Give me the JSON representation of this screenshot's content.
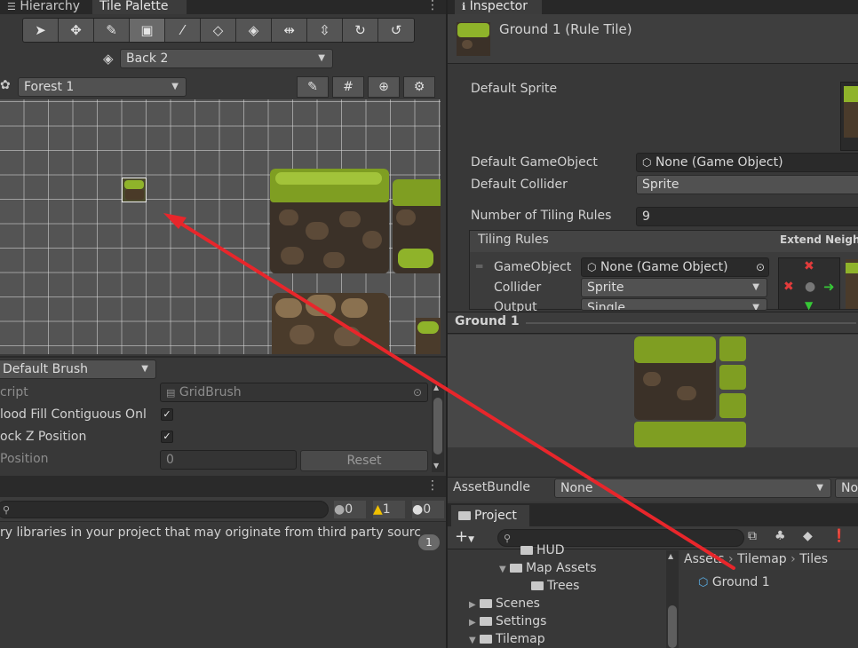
{
  "left_tabs": {
    "hierarchy": "Hierarchy",
    "tile_palette": "Tile Palette"
  },
  "toolbar": {
    "tools": [
      "select-arrow-icon",
      "move-icon",
      "paintbrush-icon",
      "box-fill-icon",
      "picker-icon",
      "eraser-icon",
      "bucket-icon",
      "flip-x-icon",
      "flip-y-icon",
      "rotate-cw-icon",
      "rotate-ccw-icon"
    ]
  },
  "layer_dropdown": {
    "value": "Back 2"
  },
  "palette_dropdown": {
    "value": "Forest 1"
  },
  "brush_panel": {
    "brush_dropdown": "Default Brush",
    "script_label": "cript",
    "script_value": "GridBrush",
    "flood_fill_label": "lood Fill Contiguous Onl",
    "lock_z_label": "ock Z Position",
    "z_position_label": " Position",
    "z_position_value": "0",
    "reset_label": "Reset"
  },
  "console": {
    "error_count": "0",
    "warn_count": "1",
    "info_count": "0",
    "message": "ry libraries in your project that may originate from third party sourc",
    "collapse_count": "1"
  },
  "inspector": {
    "tab": "Inspector",
    "asset_title": "Ground 1 (Rule Tile)",
    "default_sprite_label": "Default Sprite",
    "default_gameobject_label": "Default GameObject",
    "default_gameobject_value": "None (Game Object)",
    "default_collider_label": "Default Collider",
    "default_collider_value": "Sprite",
    "num_rules_label": "Number of Tiling Rules",
    "num_rules_value": "9",
    "tiling_rules_label": "Tiling Rules",
    "extend_label": "Extend Neigh",
    "rule": {
      "gameobject_label": "GameObject",
      "gameobject_value": "None (Game Object)",
      "collider_label": "Collider",
      "collider_value": "Sprite",
      "output_label": "Output",
      "output_value": "Single"
    },
    "preview_title": "Ground 1",
    "assetbundle_label": "AssetBundle",
    "assetbundle_value": "None",
    "assetbundle_variant": "No"
  },
  "project": {
    "tab": "Project",
    "add_label": "+",
    "tree": [
      "HUD",
      "Map Assets",
      "Trees",
      "Scenes",
      "Settings",
      "Tilemap"
    ],
    "breadcrumb": [
      "Assets",
      "Tilemap",
      "Tiles"
    ],
    "selected_asset": "Ground 1"
  },
  "colors": {
    "accent_red": "#e8262b",
    "panel_bg": "#383838",
    "field_bg": "#2a2a2a"
  }
}
